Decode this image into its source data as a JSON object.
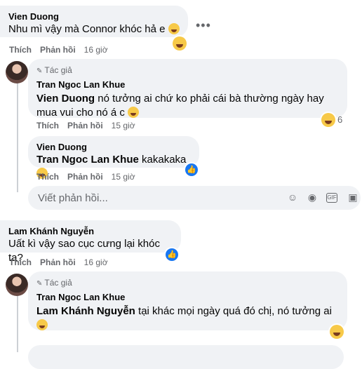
{
  "comments": [
    {
      "author": "Vien Duong",
      "text": "Nhu mì vậy mà Connor khóc hả e",
      "like_label": "Thích",
      "reply_label": "Phản hồi",
      "time": "16 giờ"
    },
    {
      "author_badge": "Tác giả",
      "author": "Tran Ngoc Lan Khue",
      "mention": "Vien Duong",
      "text": " nó tưởng ai chứ ko phải cái bà thường ngày hay mua vui cho nó á c",
      "reaction_count": "6",
      "like_label": "Thích",
      "reply_label": "Phản hồi",
      "time": "15 giờ"
    },
    {
      "author": "Vien Duong",
      "mention": "Tran Ngoc Lan Khue",
      "text": " kakakaka",
      "like_label": "Thích",
      "reply_label": "Phản hồi",
      "time": "15 giờ"
    },
    {
      "author": "Lam Khánh Nguyễn",
      "text": "Uất kì vậy sao cục cưng lại khóc ta?",
      "like_label": "Thích",
      "reply_label": "Phản hồi",
      "time": "16 giờ"
    },
    {
      "author_badge": "Tác giả",
      "author": "Tran Ngoc Lan Khue",
      "mention": "Lam Khánh Nguyễn",
      "text": " tại khác mọi ngày quá đó chị, nó tưởng ai"
    }
  ],
  "reply_box": {
    "placeholder": "Viết phản hồi..."
  },
  "more_options": "•••",
  "icons": [
    "more-dots-icon",
    "emoji-icon",
    "camera-icon",
    "gif-icon",
    "sticker-icon",
    "haha-reaction-icon",
    "like-reaction-icon",
    "pen-icon"
  ]
}
